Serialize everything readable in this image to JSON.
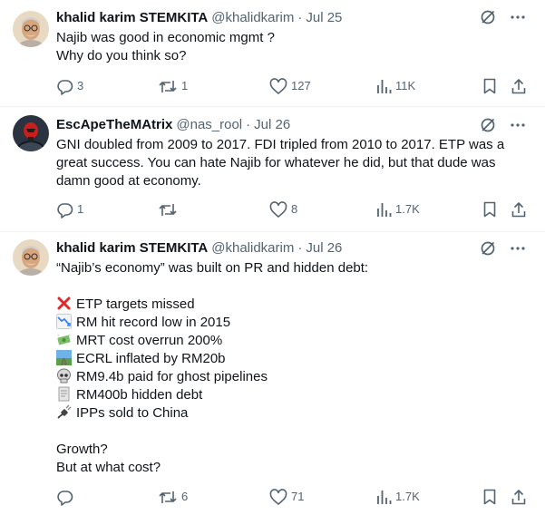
{
  "tweets": [
    {
      "author": "khalid karim STEMKITA",
      "handle": "@khalidkarim",
      "separator": "·",
      "date": "Jul 25",
      "lines": [
        "Najib was good in economic mgmt ?",
        "Why do you think so?"
      ],
      "replies": "3",
      "retweets": "1",
      "likes": "127",
      "views": "11K"
    },
    {
      "author": "EscApeTheMAtrix",
      "handle": "@nas_rool",
      "separator": "·",
      "date": "Jul 26",
      "lines": [
        "GNI doubled from 2009 to 2017. FDI tripled from 2010 to 2017. ETP was a",
        "great success. You can hate Najib for whatever he did, but that dude was",
        "damn good at economy."
      ],
      "replies": "1",
      "retweets": "",
      "likes": "8",
      "views": "1.7K"
    },
    {
      "author": "khalid karim STEMKITA",
      "handle": "@khalidkarim",
      "separator": "·",
      "date": "Jul 26",
      "intro": "“Najib’s economy” was built on PR and hidden debt:",
      "bullets": [
        {
          "icon": "cross-mark-icon",
          "text": "ETP targets missed"
        },
        {
          "icon": "chart-decreasing-icon",
          "text": "RM hit record low in 2015"
        },
        {
          "icon": "money-with-wings-icon",
          "text": "MRT cost overrun 200%"
        },
        {
          "icon": "railway-track-icon",
          "text": "ECRL inflated by RM20b"
        },
        {
          "icon": "skull-icon",
          "text": "RM9.4b paid for ghost pipelines"
        },
        {
          "icon": "receipt-icon",
          "text": "RM400b hidden debt"
        },
        {
          "icon": "electric-plug-icon",
          "text": "IPPs sold to China"
        }
      ],
      "outro": [
        "Growth?",
        "But at what cost?"
      ],
      "replies": "",
      "retweets": "6",
      "likes": "71",
      "views": "1.7K"
    }
  ]
}
